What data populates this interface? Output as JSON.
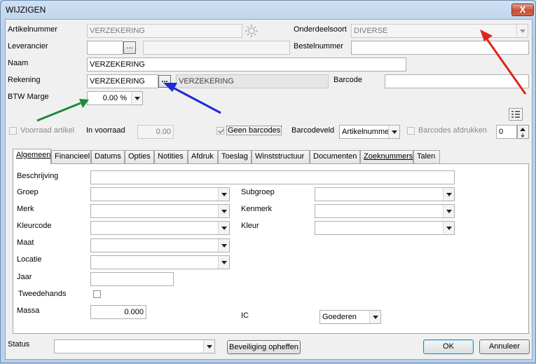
{
  "window": {
    "title": "WIJZIGEN",
    "close_label": "X"
  },
  "header": {
    "artikelnummer": {
      "label": "Artikelnummer",
      "value": "VERZEKERING"
    },
    "onderdeelsoort": {
      "label": "Onderdeelsoort",
      "value": "DIVERSE"
    },
    "leverancier": {
      "label": "Leverancier",
      "value": "",
      "browse": "...",
      "name_value": ""
    },
    "bestelnummer": {
      "label": "Bestelnummer",
      "value": ""
    },
    "naam": {
      "label": "Naam",
      "value": "VERZEKERING"
    },
    "rekening": {
      "label": "Rekening",
      "value": "VERZEKERING",
      "browse": "...",
      "name_value": "VERZEKERING"
    },
    "barcode": {
      "label": "Barcode",
      "value": ""
    },
    "btw_marge": {
      "label": "BTW Marge",
      "value": "0.00 %"
    },
    "voorraad_artikel": {
      "label": "Voorraad artikel",
      "checked": false
    },
    "in_voorraad": {
      "label": "In voorraad",
      "value": "0.00"
    },
    "geen_barcodes": {
      "label": "Geen barcodes",
      "checked": true
    },
    "barcodeveld": {
      "label": "Barcodeveld",
      "value": "Artikelnummer"
    },
    "barcodes_afdrukken": {
      "label": "Barcodes afdrukken",
      "checked": false,
      "count": "0"
    }
  },
  "tabs": [
    {
      "label": "Algemeen",
      "active": true
    },
    {
      "label": "Financieel"
    },
    {
      "label": "Datums"
    },
    {
      "label": "Opties"
    },
    {
      "label": "Notities"
    },
    {
      "label": "Afdruk"
    },
    {
      "label": "Toeslag"
    },
    {
      "label": "Winststructuur"
    },
    {
      "label": "Documenten"
    },
    {
      "label": "Zoeknummers"
    },
    {
      "label": "Talen"
    }
  ],
  "algemeen": {
    "beschrijving": {
      "label": "Beschrijving",
      "value": ""
    },
    "groep": {
      "label": "Groep",
      "value": ""
    },
    "subgroep": {
      "label": "Subgroep",
      "value": ""
    },
    "merk": {
      "label": "Merk",
      "value": ""
    },
    "kenmerk": {
      "label": "Kenmerk",
      "value": ""
    },
    "kleurcode": {
      "label": "Kleurcode",
      "value": ""
    },
    "kleur": {
      "label": "Kleur",
      "value": ""
    },
    "maat": {
      "label": "Maat",
      "value": ""
    },
    "locatie": {
      "label": "Locatie",
      "value": ""
    },
    "jaar": {
      "label": "Jaar",
      "value": ""
    },
    "tweedehands": {
      "label": "Tweedehands",
      "checked": false
    },
    "massa": {
      "label": "Massa",
      "value": "0.000"
    },
    "ic": {
      "label": "IC",
      "value": "Goederen"
    }
  },
  "footer": {
    "status": {
      "label": "Status",
      "value": ""
    },
    "beveiliging_label": "Beveiliging opheffen",
    "ok_label": "OK",
    "annuleer_label": "Annuleer"
  },
  "annotation_colors": {
    "red": "#e0241b",
    "blue": "#1f2bd6",
    "green": "#1e8a3a"
  }
}
